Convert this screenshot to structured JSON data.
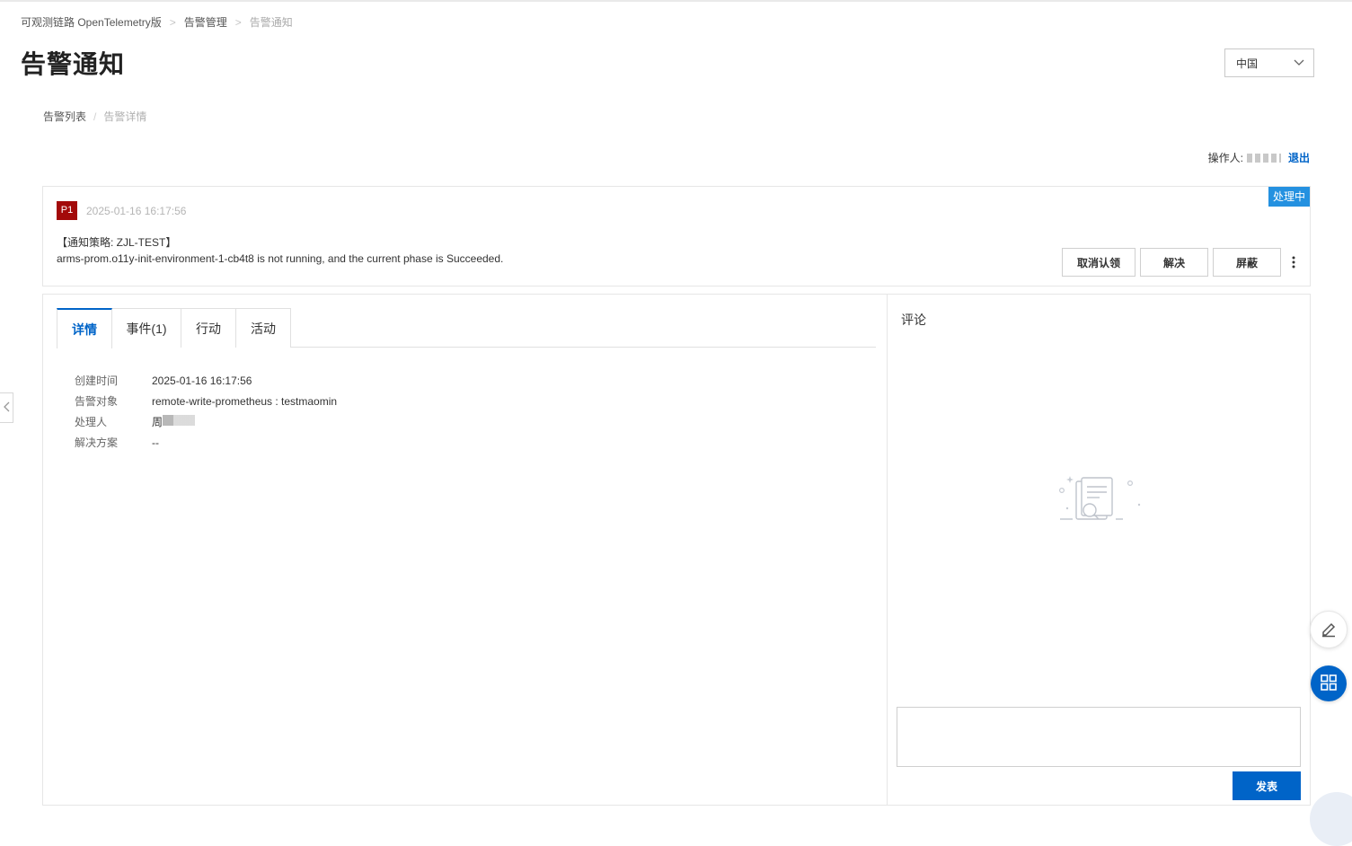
{
  "breadcrumb": {
    "items": [
      "可观测链路 OpenTelemetry版",
      "告警管理",
      "告警通知"
    ],
    "separator": ">"
  },
  "page": {
    "title": "告警通知"
  },
  "region": {
    "selected": "中国"
  },
  "sub_breadcrumb": {
    "items": [
      "告警列表",
      "告警详情"
    ],
    "separator": "/"
  },
  "operator": {
    "label": "操作人:",
    "logout": "退出"
  },
  "alert": {
    "status": "处理中",
    "priority": "P1",
    "time": "2025-01-16 16:17:56",
    "policy": "【通知策略: ZJL-TEST】",
    "message": "arms-prom.o11y-init-environment-1-cb4t8 is not running, and the current phase is Succeeded.",
    "actions": [
      "取消认领",
      "解决",
      "屏蔽"
    ]
  },
  "tabs": [
    {
      "label": "详情",
      "active": true
    },
    {
      "label": "事件(1)",
      "active": false
    },
    {
      "label": "行动",
      "active": false
    },
    {
      "label": "活动",
      "active": false
    }
  ],
  "details": [
    {
      "key": "创建时间",
      "value": "2025-01-16 16:17:56"
    },
    {
      "key": "告警对象",
      "value": "remote-write-prometheus : testmaomin"
    },
    {
      "key": "处理人",
      "value": "周"
    },
    {
      "key": "解决方案",
      "value": "--"
    }
  ],
  "comments": {
    "title": "评论",
    "submit": "发表"
  },
  "colors": {
    "primary": "#0064c8",
    "status_tag": "#2491e0",
    "priority": "#a30a0a"
  }
}
